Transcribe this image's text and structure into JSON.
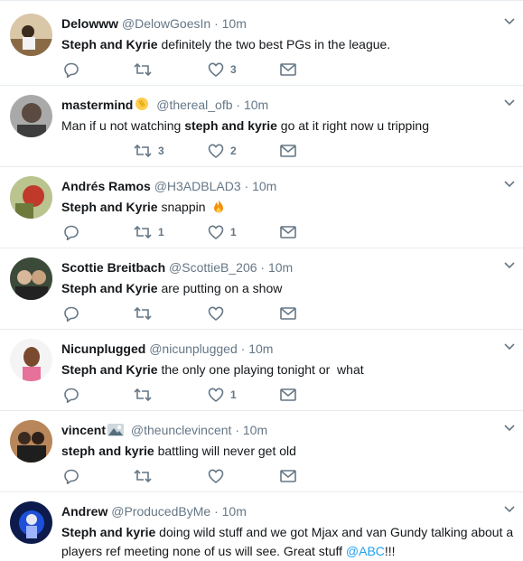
{
  "tweets": [
    {
      "name": "Delowww",
      "handle": "@DelowGoesIn",
      "dot": "·",
      "time": "10m",
      "text_bold": "Steph and Kyrie",
      "text_rest": " definitely the two best PGs in the league.",
      "retweets": "",
      "likes": "3"
    },
    {
      "name": "mastermind",
      "handle": "@thereal_ofb",
      "dot": "·",
      "time": "10m",
      "text_pre": "Man if u not watching ",
      "text_bold": "steph and kyrie",
      "text_rest": " go at it right now u tripping",
      "retweets": "3",
      "likes": "2"
    },
    {
      "name": "Andrés Ramos",
      "handle": "@H3ADBLAD3",
      "dot": "·",
      "time": "10m",
      "text_bold": "Steph and Kyrie",
      "text_rest": " snappin",
      "retweets": "1",
      "likes": "1"
    },
    {
      "name": "Scottie Breitbach",
      "handle": "@ScottieB_206",
      "dot": "·",
      "time": "10m",
      "text_bold": "Steph and Kyrie",
      "text_rest": " are putting on a show",
      "retweets": "",
      "likes": ""
    },
    {
      "name": "Nicunplugged",
      "handle": "@nicunplugged",
      "dot": "·",
      "time": "10m",
      "text_bold": "Steph and Kyrie",
      "text_rest": " the only one playing tonight or  what",
      "retweets": "",
      "likes": "1"
    },
    {
      "name": "vincent",
      "handle": "@theunclevincent",
      "dot": "·",
      "time": "10m",
      "text_bold": "steph and kyrie",
      "text_rest": " battling will never get old",
      "retweets": "",
      "likes": ""
    },
    {
      "name": "Andrew",
      "handle": "@ProducedByMe",
      "dot": "·",
      "time": "10m",
      "text_bold": "Steph and kyrie",
      "text_rest": " doing wild stuff and we got Mjax and van Gundy talking about a players ref meeting none of us will see. Great stuff ",
      "mention": "@ABC",
      "text_end": "!!!"
    }
  ],
  "colors": {
    "link": "#1da1f2",
    "muted": "#657786",
    "text": "#14171a",
    "divider": "#e6ecf0"
  },
  "icons": {
    "reply": "reply-icon",
    "retweet": "retweet-icon",
    "like": "heart-icon",
    "message": "envelope-icon",
    "menu": "chevron-down-icon",
    "fire": "fire-emoji",
    "clap": "clap-emoji",
    "badge": "emoji-badge"
  }
}
